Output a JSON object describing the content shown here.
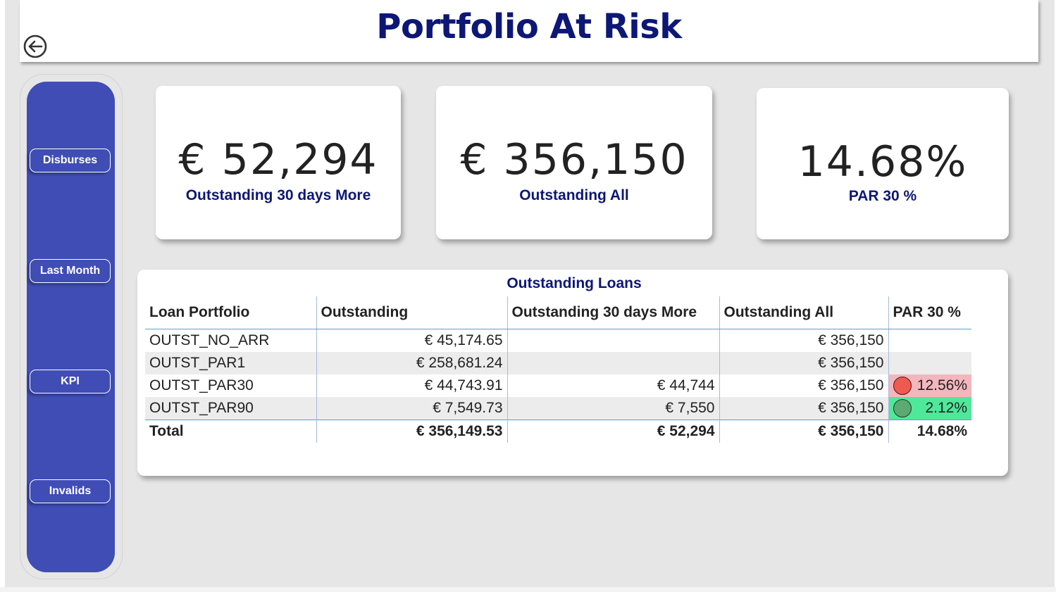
{
  "header": {
    "title": "Portfolio At Risk"
  },
  "icons": {
    "back": "back-arrow-icon"
  },
  "nav": {
    "buttons": [
      {
        "label": "Disburses"
      },
      {
        "label": "Last Month"
      },
      {
        "label": "KPI"
      },
      {
        "label": "Invalids"
      }
    ]
  },
  "cards": [
    {
      "value": "€ 52,294",
      "label": "Outstanding 30 days More"
    },
    {
      "value": "€ 356,150",
      "label": "Outstanding All"
    },
    {
      "value": "14.68%",
      "label": "PAR 30 %"
    }
  ],
  "table": {
    "title": "Outstanding Loans",
    "columns": [
      "Loan Portfolio",
      "Outstanding",
      "Outstanding 30 days More",
      "Outstanding All",
      "PAR 30 %"
    ],
    "rows": [
      {
        "portfolio": "OUTST_NO_ARR",
        "outstanding": "€ 45,174.65",
        "outstanding_30": "",
        "outstanding_all": "€ 356,150",
        "par30": ""
      },
      {
        "portfolio": "OUTST_PAR1",
        "outstanding": "€ 258,681.24",
        "outstanding_30": "",
        "outstanding_all": "€ 356,150",
        "par30": ""
      },
      {
        "portfolio": "OUTST_PAR30",
        "outstanding": "€ 44,743.91",
        "outstanding_30": "€ 44,744",
        "outstanding_all": "€ 356,150",
        "par30": "12.56%"
      },
      {
        "portfolio": "OUTST_PAR90",
        "outstanding": "€ 7,549.73",
        "outstanding_30": "€ 7,550",
        "outstanding_all": "€ 356,150",
        "par30": "2.12%"
      }
    ],
    "total": {
      "portfolio": "Total",
      "outstanding": "€ 356,149.53",
      "outstanding_30": "€ 52,294",
      "outstanding_all": "€ 356,150",
      "par30": "14.68%"
    }
  },
  "colors": {
    "title": "#0d1775",
    "sidebar": "#3f4db5",
    "par_red_bg": "#f4b6bd",
    "par_green_bg": "#4ee89a",
    "indicator_red": "#ee5a50",
    "indicator_green": "#5aaa72"
  }
}
